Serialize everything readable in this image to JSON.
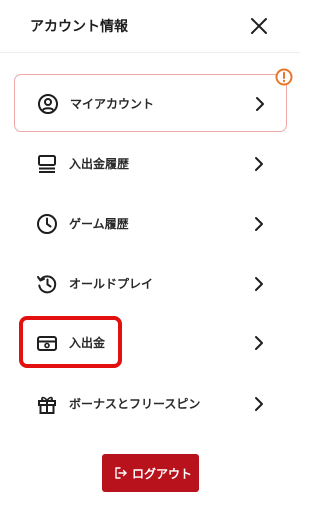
{
  "header": {
    "title": "アカウント情報",
    "close_icon": "close-icon"
  },
  "menu": {
    "items": [
      {
        "label": "マイアカウント",
        "icon": "user-circle-icon",
        "active": true,
        "alert": true
      },
      {
        "label": "入出金履歴",
        "icon": "stacked-list-icon"
      },
      {
        "label": "ゲーム履歴",
        "icon": "clock-icon"
      },
      {
        "label": "オールドプレイ",
        "icon": "history-icon"
      },
      {
        "label": "入出金",
        "icon": "cash-icon",
        "highlighted": true
      },
      {
        "label": "ボーナスとフリースピン",
        "icon": "gift-icon"
      }
    ]
  },
  "logout": {
    "label": "ログアウト",
    "icon": "logout-icon"
  },
  "colors": {
    "accent": "#b8121d",
    "alert": "#e8772a",
    "highlight": "#e31010",
    "active_border": "#f1a8a8"
  }
}
